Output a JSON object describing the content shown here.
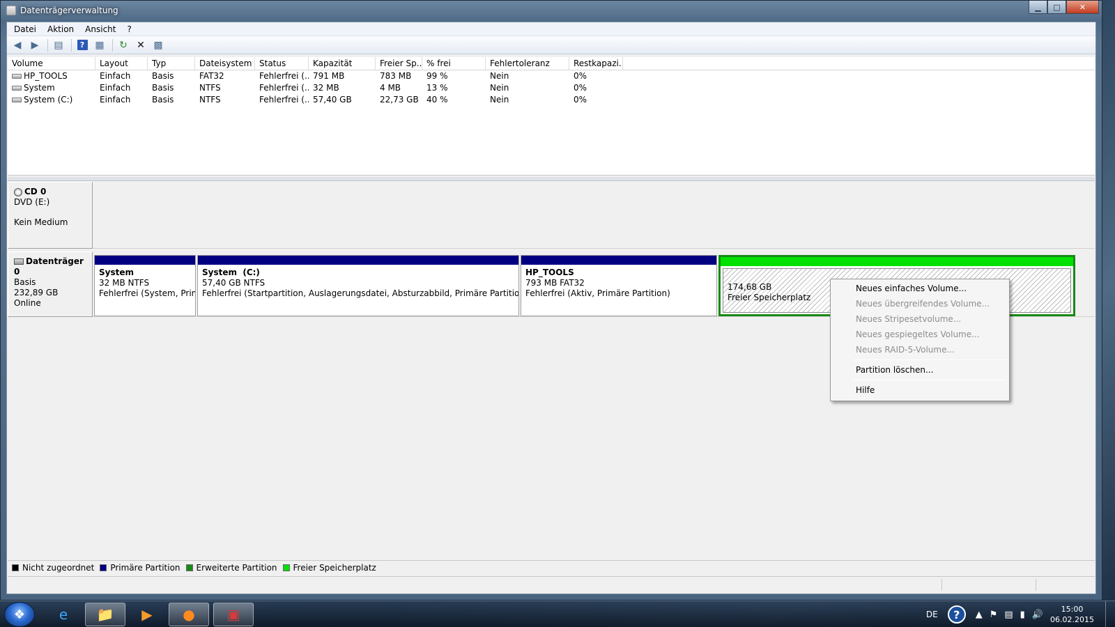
{
  "window": {
    "title": "Datenträgerverwaltung",
    "min_label": "▁",
    "max_label": "□",
    "close_label": "✕"
  },
  "menubar": {
    "items": [
      "Datei",
      "Aktion",
      "Ansicht",
      "?"
    ]
  },
  "toolbar": {
    "icons": [
      "back-icon",
      "forward-icon",
      "console-tree-icon",
      "help-icon",
      "properties-icon",
      "refresh-icon",
      "delete-icon",
      "export-icon"
    ],
    "help_glyph": "?"
  },
  "volume_list": {
    "columns": [
      "Volume",
      "Layout",
      "Typ",
      "Dateisystem",
      "Status",
      "Kapazität",
      "Freier Sp...",
      "% frei",
      "Fehlertoleranz",
      "Restkapazi..."
    ],
    "rows": [
      [
        "HP_TOOLS",
        "Einfach",
        "Basis",
        "FAT32",
        "Fehlerfrei (...",
        "791 MB",
        "783 MB",
        "99 %",
        "Nein",
        "0%"
      ],
      [
        "System",
        "Einfach",
        "Basis",
        "NTFS",
        "Fehlerfrei (...",
        "32 MB",
        "4 MB",
        "13 %",
        "Nein",
        "0%"
      ],
      [
        "System (C:)",
        "Einfach",
        "Basis",
        "NTFS",
        "Fehlerfrei (...",
        "57,40 GB",
        "22,73 GB",
        "40 %",
        "Nein",
        "0%"
      ]
    ]
  },
  "disks": {
    "cd0": {
      "name": "CD 0",
      "type": "DVD (E:)",
      "state": "Kein Medium"
    },
    "disk0": {
      "name": "Datenträger 0",
      "type": "Basis",
      "size": "232,89 GB",
      "state": "Online",
      "partitions": [
        {
          "name": "System",
          "size": "32 MB NTFS",
          "status": "Fehlerfrei (System, Primär"
        },
        {
          "name": "System  (C:)",
          "size": "57,40 GB NTFS",
          "status": "Fehlerfrei (Startpartition, Auslagerungsdatei, Absturzabbild, Primäre Partition)"
        },
        {
          "name": "HP_TOOLS",
          "size": "793 MB FAT32",
          "status": "Fehlerfrei (Aktiv, Primäre Partition)"
        },
        {
          "name": "",
          "size": "174,68 GB",
          "status": "Freier Speicherplatz"
        }
      ]
    }
  },
  "legend": {
    "items": [
      {
        "label": "Nicht zugeordnet",
        "color": "#000000"
      },
      {
        "label": "Primäre Partition",
        "color": "#000080"
      },
      {
        "label": "Erweiterte Partition",
        "color": "#178a17"
      },
      {
        "label": "Freier Speicherplatz",
        "color": "#00e100"
      }
    ]
  },
  "context_menu": {
    "items": [
      {
        "label": "Neues einfaches Volume...",
        "enabled": true
      },
      {
        "label": "Neues übergreifendes Volume...",
        "enabled": false
      },
      {
        "label": "Neues Stripesetvolume...",
        "enabled": false
      },
      {
        "label": "Neues gespiegeltes Volume...",
        "enabled": false
      },
      {
        "label": "Neues RAID-5-Volume...",
        "enabled": false
      },
      {
        "label": "Partition löschen...",
        "enabled": true
      },
      {
        "label": "Hilfe",
        "enabled": true
      }
    ]
  },
  "taskbar": {
    "apps": [
      "windows-start-icon",
      "internet-explorer-icon",
      "file-explorer-icon",
      "media-player-icon",
      "firefox-icon",
      "computer-management-icon"
    ],
    "tray": {
      "language": "DE",
      "help_glyph": "?",
      "time": "15:00",
      "date": "06.02.2015"
    }
  }
}
